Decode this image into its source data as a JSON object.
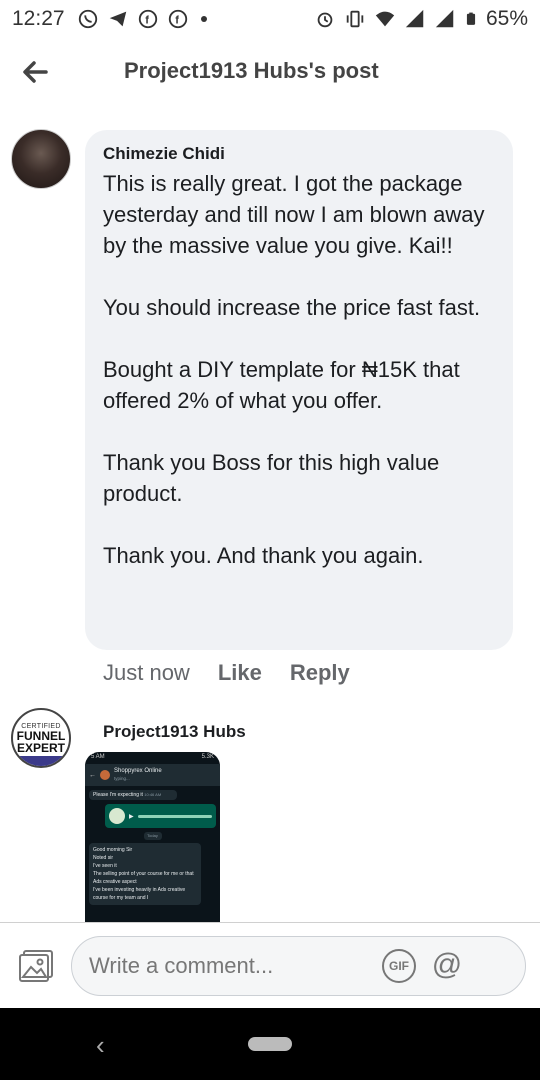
{
  "status_bar": {
    "time": "12:27",
    "battery": "65%",
    "icons_left": [
      "whatsapp-icon",
      "telegram-icon",
      "facebook-icon",
      "facebook-icon",
      "dot-icon"
    ],
    "icons_right": [
      "alarm-icon",
      "vibrate-icon",
      "wifi-icon",
      "signal-icon",
      "signal-icon",
      "battery-icon"
    ]
  },
  "header": {
    "title": "Project1913 Hubs's post"
  },
  "comment1": {
    "author": "Chimezie Chidi",
    "paragraphs": [
      "This is really great. I got the package yesterday and till now I am blown away by the massive value you give. Kai!!",
      "You should increase the price fast fast.",
      "Bought a DIY template for ₦15K that offered 2% of what you offer.",
      "Thank you Boss for this high value product.",
      "Thank you. And thank you again."
    ],
    "time_ago": "Just now",
    "like_label": "Like",
    "reply_label": "Reply"
  },
  "comment2": {
    "author": "Project1913 Hubs",
    "avatar_text": {
      "line1": "CERTIFIED",
      "line2": "FUNNEL",
      "line3": "EXPERT"
    },
    "screenshot": {
      "status_time": "5 AM",
      "status_right": "5.3K",
      "chat_name": "Shoppyrex Online",
      "chat_status": "typing...",
      "msg1": "Please I'm expecting it",
      "msg1_time": "10:46 AM",
      "today": "Today",
      "lines": [
        "Good morning Sir",
        "Noted sir",
        "I've seen it",
        "The selling point of your course for me or that Ads creative aspect",
        "I've been investing heavily in Ads creative course for my team and I"
      ]
    }
  },
  "composer": {
    "placeholder": "Write a comment...",
    "gif_label": "GIF",
    "mention_label": "@"
  },
  "colors": {
    "bubble_bg": "#f0f2f5",
    "meta_text": "#65676b",
    "nav_bg": "#000000"
  }
}
